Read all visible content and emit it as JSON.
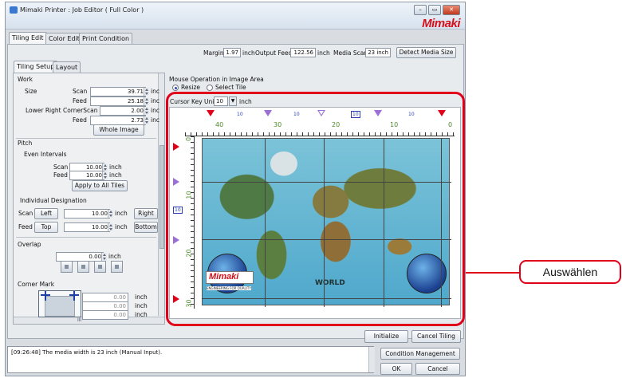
{
  "window": {
    "title": "Mimaki Printer : Job Editor ( Full Color )",
    "brand": "Mimaki",
    "minimize": "–",
    "maximize": "▭",
    "close": "✕"
  },
  "main_tabs": [
    "Tiling Edit",
    "Color Edit",
    "Print Condition"
  ],
  "header": {
    "margin_label": "Margin",
    "margin_value": "1.97",
    "margin_unit": "inch",
    "output_feed_label": "Output Feed",
    "output_feed_value": "122.56",
    "output_feed_unit": "inch",
    "media_scan_label": "Media Scan",
    "media_scan_value": "23 inch",
    "detect_button": "Detect Media Size"
  },
  "sub_tabs": [
    "Tiling Setup",
    "Layout"
  ],
  "work": {
    "heading": "Work",
    "size_label": "Size",
    "scan_label": "Scan",
    "scan_value": "39.71",
    "scan_unit": "inc",
    "feed_label": "Feed",
    "feed_value": "25.18",
    "feed_unit": "inc",
    "lower_right_label": "Lower Right CornerScan",
    "lr_scan_value": "2.00",
    "lr_scan_unit": "inc",
    "lr_feed_label": "Feed",
    "lr_feed_value": "2.73",
    "lr_feed_unit": "inc",
    "whole_image_button": "Whole Image"
  },
  "pitch": {
    "heading": "Pitch",
    "even_label": "Even Intervals",
    "scan_label": "Scan",
    "scan_value": "10.00",
    "scan_unit": "inch",
    "feed_label": "Feed",
    "feed_value": "10.00",
    "feed_unit": "inch",
    "apply_button": "Apply to All Tiles"
  },
  "individual": {
    "heading": "Individual Designation",
    "scan_label": "Scan",
    "left_button": "Left",
    "scan_value": "10.00",
    "scan_unit": "inch",
    "right_button": "Right",
    "feed_label": "Feed",
    "top_button": "Top",
    "feed_value": "10.00",
    "feed_unit": "inch",
    "bottom_button": "Bottom"
  },
  "overlap": {
    "heading": "Overlap",
    "value": "0.00",
    "unit": "inch"
  },
  "corner_mark": {
    "heading": "Corner Mark",
    "values": [
      "0.00",
      "0.00",
      "0.00"
    ],
    "unit": "inch"
  },
  "scrollbar": {
    "thumb_label": "III"
  },
  "mouse_operation": {
    "heading": "Mouse Operation in Image Area",
    "resize_label": "Resize",
    "select_label": "Select Tile"
  },
  "cursor_key": {
    "label": "Cursor Key Unit",
    "value": "10",
    "unit": "inch"
  },
  "rulers": {
    "top_numbers": [
      "40",
      "30",
      "20",
      "10",
      "0"
    ],
    "top_markers": [
      "10",
      "10",
      "10",
      "10",
      "10",
      "10"
    ],
    "left_numbers": [
      "0",
      "10",
      "20",
      "30"
    ],
    "left_marker": "10"
  },
  "image_text": {
    "banner": "Mimaki",
    "banner_sub": "ENGINEERING FOR QUALITY",
    "world": "WORLD"
  },
  "footer_buttons": {
    "initialize": "Initialize",
    "cancel_tiling": "Cancel Tiling"
  },
  "log": {
    "message": "[09:26:48] The media width is 23 inch (Manual Input)."
  },
  "bottom_buttons": {
    "condition_management": "Condition Management",
    "ok": "OK",
    "cancel": "Cancel"
  },
  "callout": {
    "label": "Auswählen"
  },
  "colors": {
    "accent_red": "#e0001a",
    "window_bg": "#d9dde2",
    "ruler_text": "#4a8a2a",
    "marker_blue": "#2b3fb8"
  }
}
